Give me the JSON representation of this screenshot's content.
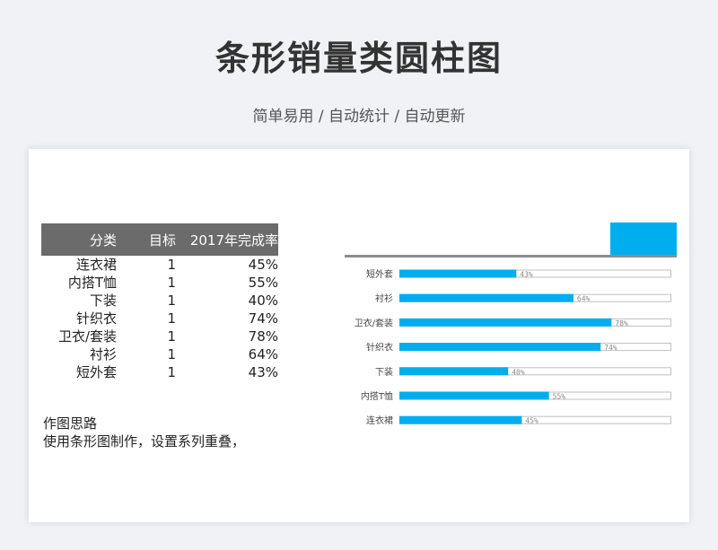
{
  "page": {
    "title": "条形销量类圆柱图",
    "subtitle": "简单易用 / 自动统计 / 自动更新"
  },
  "table": {
    "headers": [
      "分类",
      "目标",
      "2017年完成率"
    ],
    "rows": [
      [
        "连衣裙",
        "1",
        "45%"
      ],
      [
        "内搭T恤",
        "1",
        "55%"
      ],
      [
        "下装",
        "1",
        "40%"
      ],
      [
        "针织衣",
        "1",
        "74%"
      ],
      [
        "卫衣/套装",
        "1",
        "78%"
      ],
      [
        "衬衫",
        "1",
        "64%"
      ],
      [
        "短外套",
        "1",
        "43%"
      ]
    ]
  },
  "notes": {
    "heading": "作图思路",
    "body": "使用条形图制作，设置系列重叠，"
  },
  "colors": {
    "bar": "#00aeef",
    "track_border": "#bfbfbf",
    "header_bg": "#6b6b6b",
    "axis_line": "#8c8c8c"
  },
  "chart_data": {
    "type": "bar",
    "orientation": "horizontal",
    "categories": [
      "短外套",
      "衬衫",
      "卫衣/套装",
      "针织衣",
      "下装",
      "内搭T恤",
      "连衣裙"
    ],
    "series": [
      {
        "values": [
          1,
          1,
          1,
          1,
          1,
          1,
          1
        ]
      },
      {
        "values": [
          0.43,
          0.64,
          0.78,
          0.74,
          0.4,
          0.55,
          0.45
        ]
      }
    ],
    "data_labels": [
      "43%",
      "64%",
      "78%",
      "74%",
      "40%",
      "55%",
      "45%"
    ],
    "xlim": [
      0,
      1
    ],
    "grid": false,
    "legend": "none"
  }
}
